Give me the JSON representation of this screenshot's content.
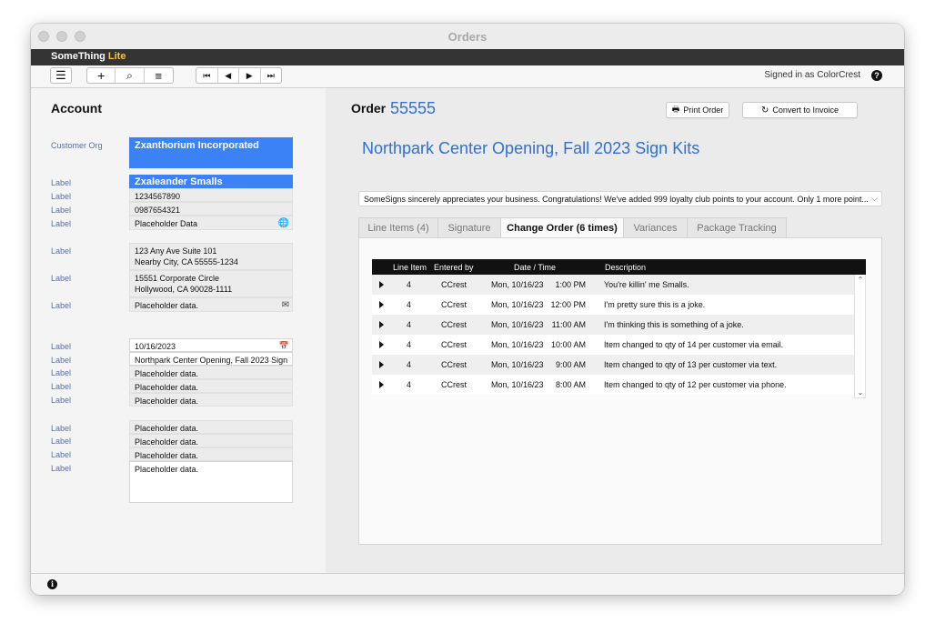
{
  "window": {
    "title": "Orders"
  },
  "brand": {
    "name": "SomeThing",
    "edition": "Lite",
    "edition_color": "#f5c542"
  },
  "toolbar": {
    "groups": [
      {
        "buttons": [
          {
            "icon": "menu-icon",
            "glyph": "☰"
          }
        ]
      },
      {
        "buttons": [
          {
            "icon": "plus-icon",
            "glyph": "+"
          },
          {
            "icon": "search-icon",
            "glyph": "⌕"
          },
          {
            "icon": "list-icon",
            "glyph": "≡"
          }
        ]
      },
      {
        "buttons": [
          {
            "icon": "first-record-icon",
            "glyph": "⏮"
          },
          {
            "icon": "previous-record-icon",
            "glyph": "◀"
          },
          {
            "icon": "next-record-icon",
            "glyph": "▶"
          },
          {
            "icon": "last-record-icon",
            "glyph": "⏭"
          }
        ]
      }
    ],
    "signed_in": "Signed in as ColorCrest",
    "help_glyph": "?"
  },
  "account": {
    "heading": "Account",
    "customer_org_label": "Customer Org",
    "customer_org": "Zxanthorium Incorporated",
    "contact_group": [
      {
        "label": "Label",
        "value": "Zxaleander Smalls"
      },
      {
        "label": "Label",
        "value": "1234567890"
      },
      {
        "label": "Label",
        "value": "0987654321"
      },
      {
        "label": "Label",
        "value": "Placeholder Data",
        "icon": "globe-icon"
      }
    ],
    "address_group": [
      {
        "label": "Label",
        "line1": "123 Any Ave Suite 101",
        "line2": "Nearby City, CA  55555-1234"
      },
      {
        "label": "Label",
        "line1": "15551 Corporate Circle",
        "line2": "Hollywood, CA  90028-1111"
      },
      {
        "label": "Label",
        "line1": "Placeholder data.",
        "line2": "",
        "icon": "envelope-icon"
      }
    ],
    "order_group": [
      {
        "label": "Label",
        "value": "10/16/2023",
        "icon": "calendar-icon"
      },
      {
        "label": "Label",
        "value": "Northpark Center Opening, Fall 2023 Sign"
      },
      {
        "label": "Label",
        "value": "Placeholder data."
      },
      {
        "label": "Label",
        "value": "Placeholder data."
      },
      {
        "label": "Label",
        "value": "Placeholder data."
      }
    ],
    "notes_group": [
      {
        "label": "Label",
        "value": "Placeholder data."
      },
      {
        "label": "Label",
        "value": "Placeholder data."
      },
      {
        "label": "Label",
        "value": "Placeholder data."
      },
      {
        "label": "Label",
        "value": "Placeholder data."
      }
    ]
  },
  "order": {
    "label": "Order",
    "number": "55555",
    "print_label": "Print Order",
    "convert_label": "Convert to Invoice",
    "title": "Northpark Center Opening, Fall 2023 Sign Kits",
    "message": "SomeSigns sincerely appreciates your business. Congratulations! We've added 999 loyalty club points to your account. Only 1 more point...",
    "accent_color": "#2f6fd6"
  },
  "tabs": [
    {
      "label": "Line Items (4)",
      "active": false
    },
    {
      "label": "Signature",
      "active": false
    },
    {
      "label": "Change Order (6 times)",
      "active": true
    },
    {
      "label": "Variances",
      "active": false
    },
    {
      "label": "Package Tracking",
      "active": false
    }
  ],
  "change_orders": {
    "columns": [
      "Line Item",
      "Entered by",
      "Date / Time",
      "Description"
    ],
    "rows": [
      {
        "line_item": "4",
        "entered_by": "CCrest",
        "date": "Mon, 10/16/23",
        "time": "1:00 PM",
        "description": "You're killin' me Smalls."
      },
      {
        "line_item": "4",
        "entered_by": "CCrest",
        "date": "Mon, 10/16/23",
        "time": "12:00 PM",
        "description": "I'm pretty sure this is a joke."
      },
      {
        "line_item": "4",
        "entered_by": "CCrest",
        "date": "Mon, 10/16/23",
        "time": "11:00 AM",
        "description": "I'm thinking this is something of a joke."
      },
      {
        "line_item": "4",
        "entered_by": "CCrest",
        "date": "Mon, 10/16/23",
        "time": "10:00 AM",
        "description": "Item changed to qty of 14 per customer via email."
      },
      {
        "line_item": "4",
        "entered_by": "CCrest",
        "date": "Mon, 10/16/23",
        "time": "9:00 AM",
        "description": "Item changed to qty of 13 per customer via text."
      },
      {
        "line_item": "4",
        "entered_by": "CCrest",
        "date": "Mon, 10/16/23",
        "time": "8:00 AM",
        "description": "Item changed to qty of 12 per customer via phone."
      }
    ]
  },
  "status": {
    "info_glyph": "i"
  }
}
